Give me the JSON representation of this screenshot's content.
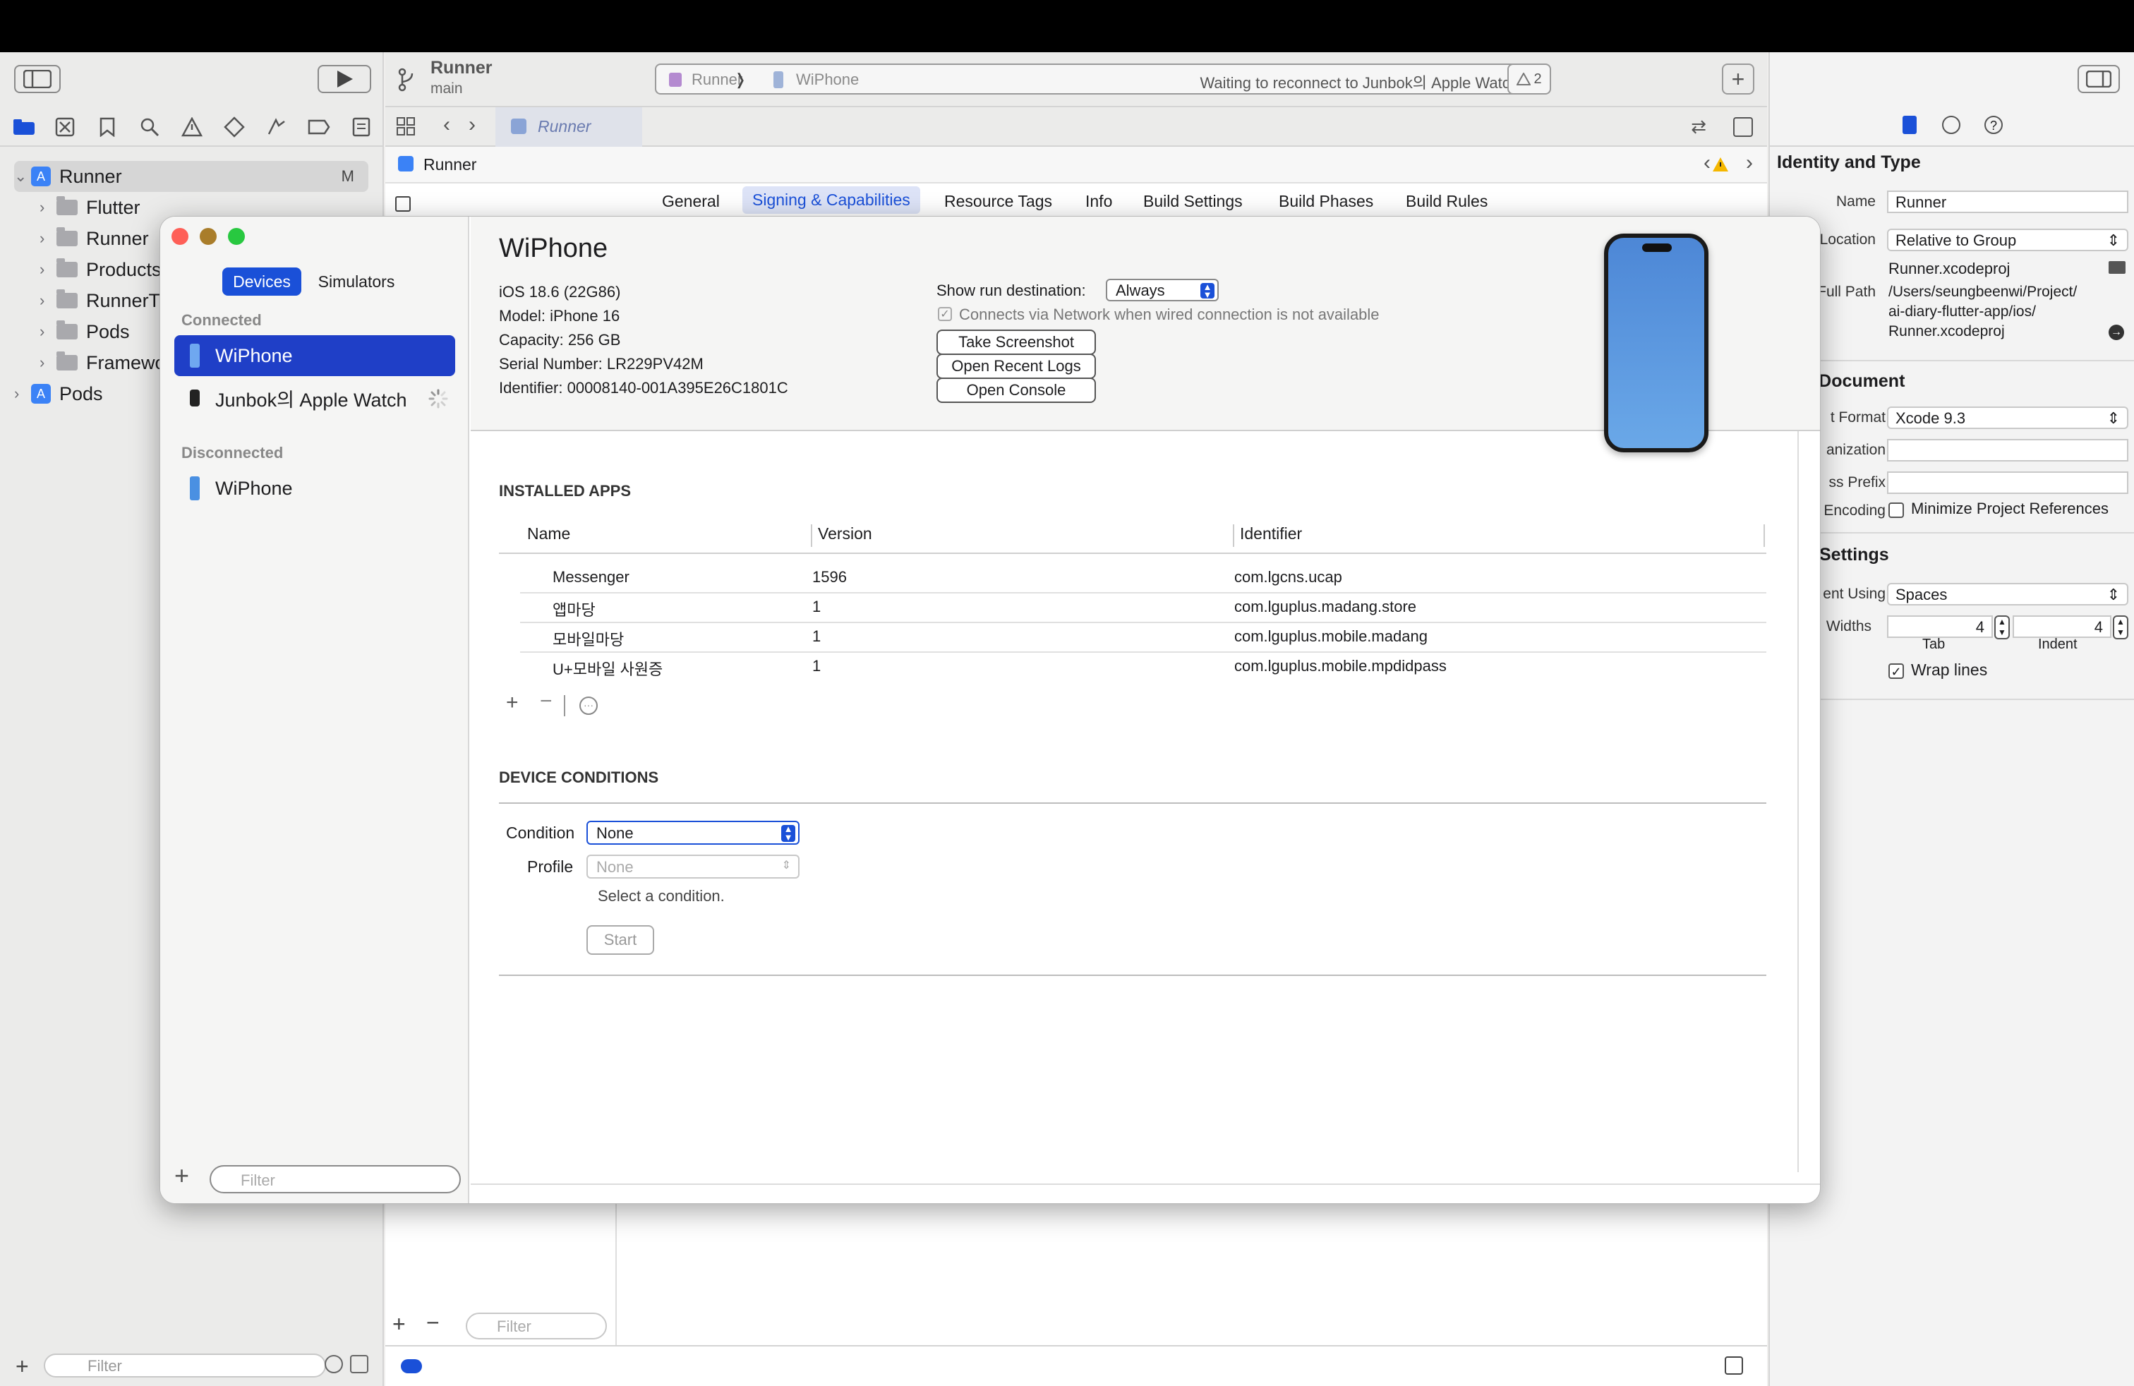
{
  "toolbar": {
    "scheme_title": "Runner",
    "scheme_branch": "main",
    "breadcrumb_scheme": "Runner",
    "breadcrumb_sep": "❭",
    "breadcrumb_device": "WiPhone",
    "activity_status": "Waiting to reconnect to Junbok의 Apple Watch",
    "warning_count": "2"
  },
  "navigator": {
    "items": [
      {
        "label": "Runner",
        "badge": "M"
      },
      {
        "label": "Flutter"
      },
      {
        "label": "Runner"
      },
      {
        "label": "Products"
      },
      {
        "label": "RunnerT"
      },
      {
        "label": "Pods"
      },
      {
        "label": "Framewo"
      },
      {
        "label": "Pods"
      }
    ],
    "filter_placeholder": "Filter"
  },
  "editor": {
    "active_tab": "Runner",
    "path_item": "Runner",
    "config_tabs": [
      "General",
      "Signing & Capabilities",
      "Resource Tags",
      "Info",
      "Build Settings",
      "Build Phases",
      "Build Rules"
    ],
    "filter_placeholder": "Filter"
  },
  "inspector": {
    "identity_header": "Identity and Type",
    "name_label": "Name",
    "name_value": "Runner",
    "location_label": "Location",
    "location_value": "Relative to Group",
    "location_file": "Runner.xcodeproj",
    "fullpath_label": "Full Path",
    "fullpath_lines": [
      "/Users/seungbeenwi/Project/",
      "ai-diary-flutter-app/ios/",
      "Runner.xcodeproj"
    ],
    "project_doc_header": "ct Document",
    "format_label": "t Format",
    "format_value": "Xcode 9.3",
    "org_label": "anization",
    "prefix_label": "ss Prefix",
    "encoding_label": "Encoding",
    "minimize_label": "Minimize Project References",
    "text_settings_header": "Settings",
    "indent_using_label": "ent Using",
    "indent_using_value": "Spaces",
    "widths_label": "Widths",
    "tab_value": "4",
    "indent_value": "4",
    "tab_caption": "Tab",
    "indent_caption": "Indent",
    "wrap_label": "Wrap lines"
  },
  "devices": {
    "segments": [
      "Devices",
      "Simulators"
    ],
    "connected_header": "Connected",
    "disconnected_header": "Disconnected",
    "connected": [
      "WiPhone",
      "Junbok의 Apple Watch"
    ],
    "disconnected": [
      "WiPhone"
    ],
    "filter_placeholder": "Filter",
    "detail": {
      "name": "WiPhone",
      "ios": "iOS 18.6 (22G86)",
      "model": "Model: iPhone 16",
      "capacity": "Capacity: 256 GB",
      "serial": "Serial Number: LR229PV42M",
      "identifier": "Identifier: 00008140-001A395E26C1801C",
      "show_run_label": "Show run destination:",
      "show_run_value": "Always",
      "network_label": "Connects via Network when wired connection is not available",
      "take_screenshot": "Take Screenshot",
      "open_logs": "Open Recent Logs",
      "open_console": "Open Console"
    },
    "installed_apps_header": "INSTALLED APPS",
    "columns": [
      "Name",
      "Version",
      "Identifier"
    ],
    "apps": [
      {
        "name": "Messenger",
        "version": "1596",
        "identifier": "com.lgcns.ucap"
      },
      {
        "name": "앱마당",
        "version": "1",
        "identifier": "com.lguplus.madang.store"
      },
      {
        "name": "모바일마당",
        "version": "1",
        "identifier": "com.lguplus.mobile.madang"
      },
      {
        "name": "U+모바일 사원증",
        "version": "1",
        "identifier": "com.lguplus.mobile.mpdidpass"
      }
    ],
    "conditions_header": "DEVICE CONDITIONS",
    "condition_label": "Condition",
    "condition_value": "None",
    "profile_label": "Profile",
    "profile_value": "None",
    "hint": "Select a condition.",
    "start_button": "Start"
  },
  "colors": {
    "accent": "#1a50d8",
    "selection": "#1f3fc7"
  }
}
